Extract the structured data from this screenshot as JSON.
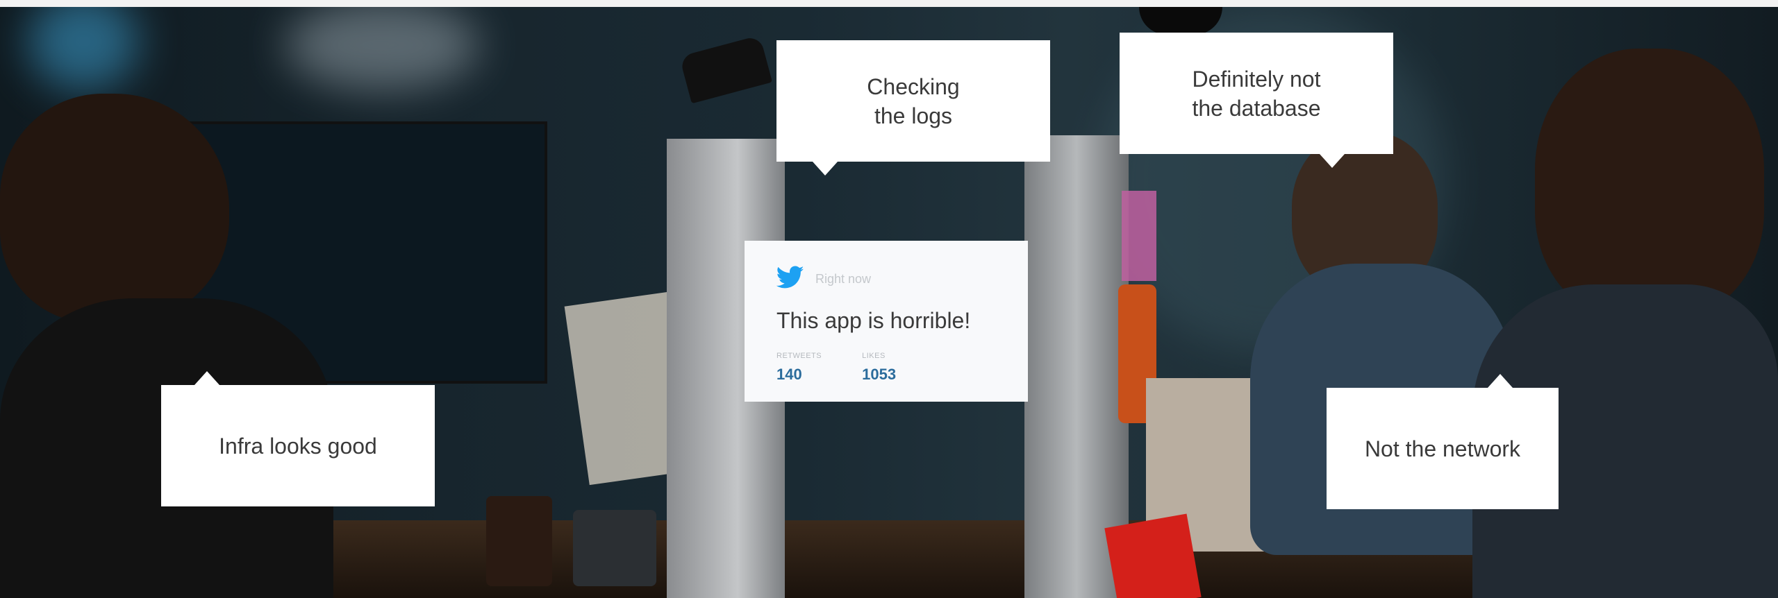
{
  "callouts": {
    "logs": [
      "Checking",
      "the logs"
    ],
    "database": [
      "Definitely not",
      "the database"
    ],
    "infra": "Infra looks good",
    "network": "Not the network"
  },
  "tweet": {
    "icon": "twitter-bird-icon",
    "time": "Right now",
    "text": "This app is horrible!",
    "retweets_label": "RETWEETS",
    "retweets": "140",
    "likes_label": "LIKES",
    "likes": "1053"
  },
  "colors": {
    "callout_bg": "#ffffff",
    "callout_text": "#3a3a3a",
    "tweet_bg": "#f8f9fb",
    "twitter_blue": "#1da1f2",
    "stat_value": "#2b6c9c"
  }
}
